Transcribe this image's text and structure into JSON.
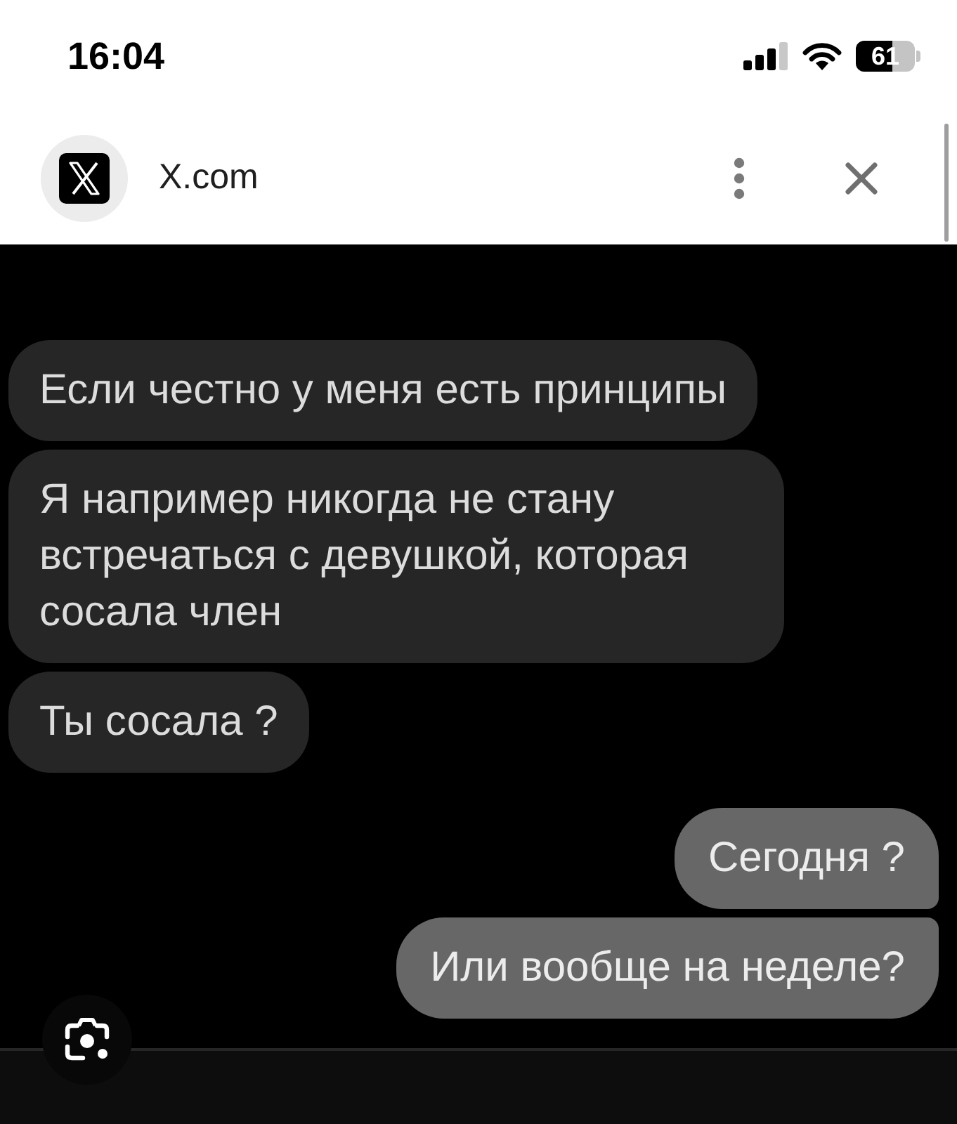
{
  "status_bar": {
    "time": "16:04",
    "battery": "61"
  },
  "browser_bar": {
    "site_name": "X.com"
  },
  "messages": [
    {
      "kind": "incoming",
      "text": "Если честно у меня есть принципы"
    },
    {
      "kind": "incoming",
      "text": "Я например никогда не стану встречаться с девушкой, которая сосала член"
    },
    {
      "kind": "incoming",
      "text": "Ты сосала ?"
    },
    {
      "kind": "outgoing",
      "text": "Сегодня ?"
    },
    {
      "kind": "outgoing",
      "text": "Или вообще на неделе?"
    }
  ]
}
